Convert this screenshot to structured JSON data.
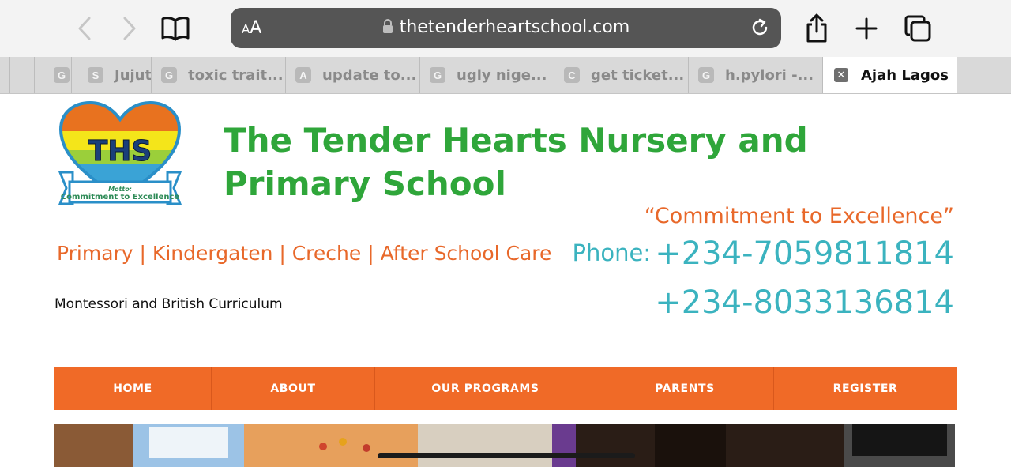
{
  "browser": {
    "text_size_label": "AA",
    "url": "thetenderheartschool.com"
  },
  "tabs": [
    {
      "favicon": "G",
      "label": ""
    },
    {
      "favicon": "S",
      "label": "Jujut"
    },
    {
      "favicon": "G",
      "label": "toxic trait..."
    },
    {
      "favicon": "A",
      "label": "update to..."
    },
    {
      "favicon": "G",
      "label": "ugly nige..."
    },
    {
      "favicon": "C",
      "label": "get ticket..."
    },
    {
      "favicon": "G",
      "label": "h.pylori -..."
    },
    {
      "favicon": "✕",
      "label": "Ajah Lagos",
      "active": true
    }
  ],
  "site": {
    "logo_letters": "THS",
    "logo_motto_caption": "Motto:",
    "logo_motto": "Commitment to Excellence",
    "title": "The Tender Hearts Nursery and Primary School",
    "motto": "“Commitment to Excellence”",
    "programs": "Primary | Kindergaten | Creche | After School Care",
    "phone_label": "Phone:",
    "phone1": "+234-7059811814",
    "phone2": "+234-8033136814",
    "curriculum": "Montessori and British Curriculum"
  },
  "nav": [
    "HOME",
    "ABOUT",
    "OUR PROGRAMS",
    "PARENTS",
    "REGISTER"
  ],
  "colors": {
    "title_green": "#2fa63a",
    "accent_orange": "#f06a27",
    "phone_teal": "#3bb3bf"
  }
}
